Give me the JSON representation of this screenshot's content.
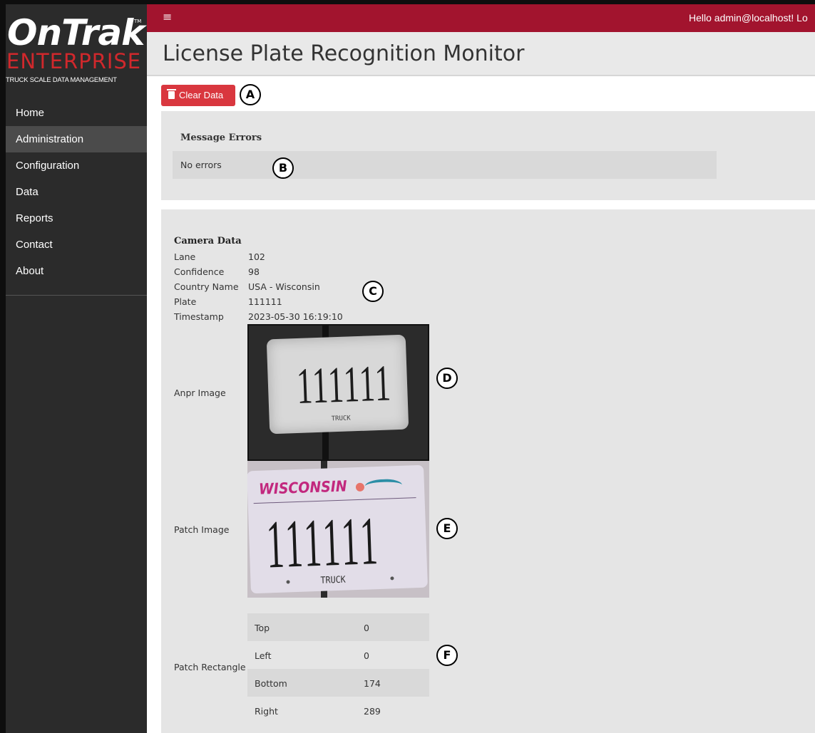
{
  "brand": {
    "name": "OnTrak",
    "tm": "TM",
    "edition": "ENTERPRISE",
    "tagline": "TRUCK SCALE DATA MANAGEMENT",
    "colors": {
      "primary": "#a2142e",
      "accent": "#d0282c",
      "sidebar": "#2b2b2b"
    }
  },
  "sidebar": {
    "items": [
      {
        "label": "Home",
        "active": false
      },
      {
        "label": "Administration",
        "active": true
      },
      {
        "label": "Configuration",
        "active": false
      },
      {
        "label": "Data",
        "active": false
      },
      {
        "label": "Reports",
        "active": false
      },
      {
        "label": "Contact",
        "active": false
      },
      {
        "label": "About",
        "active": false
      }
    ]
  },
  "topbar": {
    "menu_icon": "hamburger-menu-icon",
    "greeting": "Hello admin@localhost!  Lo"
  },
  "page": {
    "title": "License Plate Recognition Monitor"
  },
  "toolbar": {
    "clear_label": "Clear Data",
    "clear_icon": "trash-icon"
  },
  "errors": {
    "title": "Message Errors",
    "message": "No errors"
  },
  "camera": {
    "title": "Camera Data",
    "fields": [
      {
        "label": "Lane",
        "value": "102"
      },
      {
        "label": "Confidence",
        "value": "98"
      },
      {
        "label": "Country Name",
        "value": "USA - Wisconsin"
      },
      {
        "label": "Plate",
        "value": "111111"
      },
      {
        "label": "Timestamp",
        "value": "2023-05-30 16:19:10"
      }
    ],
    "anpr_label": "Anpr Image",
    "anpr_image": {
      "digits": "111111",
      "sub": "TRUCK"
    },
    "patch_label": "Patch Image",
    "patch_image": {
      "state": "WISCONSIN",
      "digits": "111111",
      "sub": "TRUCK"
    },
    "rect_label": "Patch Rectangle",
    "rect": [
      {
        "key": "Top",
        "value": "0"
      },
      {
        "key": "Left",
        "value": "0"
      },
      {
        "key": "Bottom",
        "value": "174"
      },
      {
        "key": "Right",
        "value": "289"
      }
    ]
  },
  "callouts": [
    "A",
    "B",
    "C",
    "D",
    "E",
    "F"
  ]
}
